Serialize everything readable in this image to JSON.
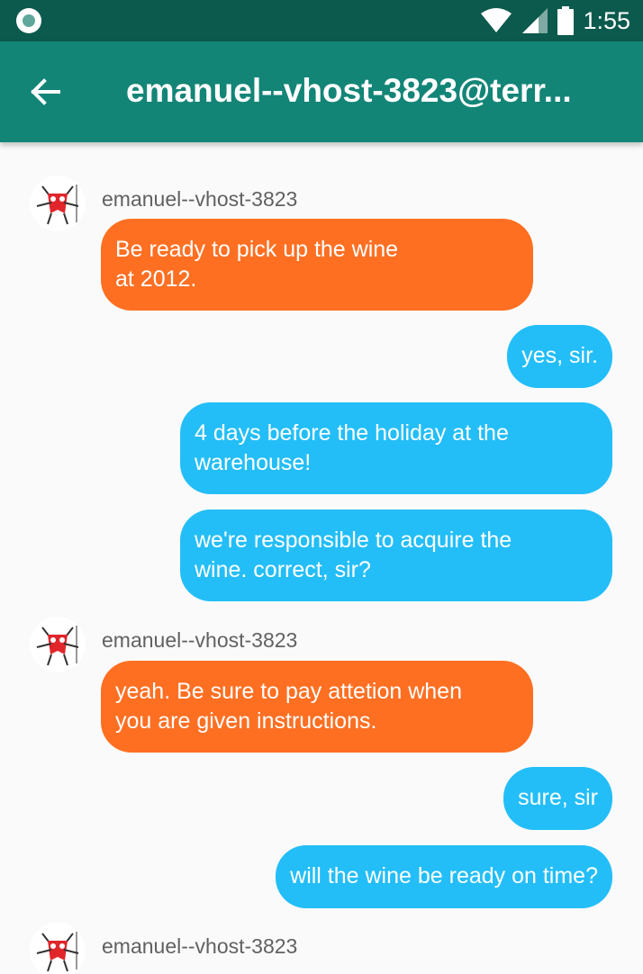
{
  "status_bar": {
    "time": "1:55"
  },
  "app_bar": {
    "title": "emanuel--vhost-3823@terr..."
  },
  "messages": [
    {
      "sender": "emanuel--vhost-3823",
      "text": "Be ready to pick up the wine\nat 2012."
    },
    {
      "text": "yes, sir."
    },
    {
      "text": "4 days before the holiday at the\nwarehouse!"
    },
    {
      "text": "we're responsible to acquire the\nwine. correct, sir?"
    },
    {
      "sender": "emanuel--vhost-3823",
      "text": "yeah. Be sure to pay attetion when\nyou are given instructions."
    },
    {
      "text": "sure, sir"
    },
    {
      "text": "will the wine be ready on time?"
    },
    {
      "sender": "emanuel--vhost-3823"
    }
  ],
  "colors": {
    "incoming": "#ff6f22",
    "outgoing": "#23bef8",
    "app_bar": "#138577",
    "status_bar": "#0b5a4d"
  },
  "icons": {
    "back": "arrow-left-icon",
    "avatar": "devil-logo"
  }
}
